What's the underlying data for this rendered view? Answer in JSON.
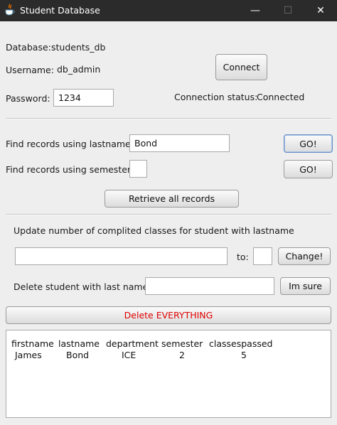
{
  "window": {
    "title": "Student Database",
    "controls": {
      "minimize": "—",
      "maximize": "☐",
      "close": "✕"
    }
  },
  "connection": {
    "database_label": "Database:",
    "database_value": "students_db",
    "username_label": "Username:",
    "username_value": "db_admin",
    "password_label": "Password:",
    "password_value": "1234",
    "connect_button": "Connect",
    "status_label": "Connection status:",
    "status_value": "Connected"
  },
  "search": {
    "lastname_label": "Find records using lastname:",
    "lastname_value": "Bond",
    "lastname_go": "GO!",
    "semester_label": "Find records using semester:",
    "semester_value": "",
    "semester_go": "GO!",
    "retrieve_all": "Retrieve all records"
  },
  "update": {
    "label": "Update number of complited classes for student with lastname",
    "lastname_value": "",
    "to_label": "to:",
    "to_value": "",
    "change_button": "Change!"
  },
  "delete": {
    "label": "Delete student with last name:",
    "value": "",
    "confirm_button": "Im sure",
    "delete_all_button": "Delete EVERYTHING"
  },
  "results": {
    "headers": [
      "firstname",
      "lastname",
      "department",
      "semester",
      "classespassed"
    ],
    "rows": [
      [
        "James",
        "Bond",
        "ICE",
        "2",
        "5"
      ]
    ]
  },
  "colors": {
    "titlebar": "#2b2b2b",
    "window_bg": "#eeeeee",
    "danger_text": "#e00000"
  }
}
